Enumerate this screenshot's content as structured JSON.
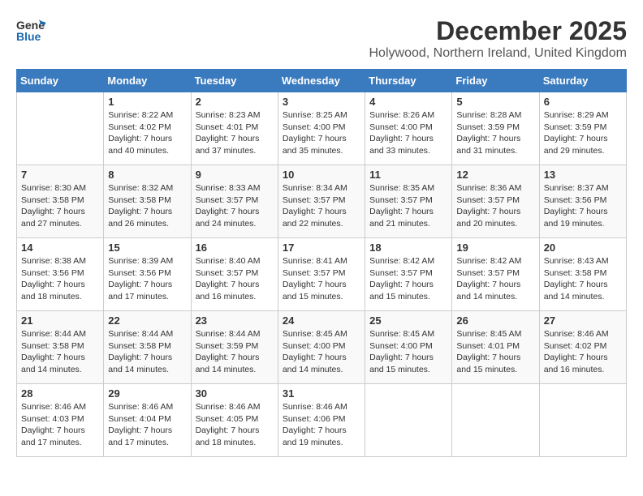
{
  "logo": {
    "text_general": "General",
    "text_blue": "Blue"
  },
  "title": {
    "month": "December 2025",
    "location": "Holywood, Northern Ireland, United Kingdom"
  },
  "weekdays": [
    "Sunday",
    "Monday",
    "Tuesday",
    "Wednesday",
    "Thursday",
    "Friday",
    "Saturday"
  ],
  "weeks": [
    [
      {
        "day": "",
        "sunrise": "",
        "sunset": "",
        "daylight": ""
      },
      {
        "day": "1",
        "sunrise": "Sunrise: 8:22 AM",
        "sunset": "Sunset: 4:02 PM",
        "daylight": "Daylight: 7 hours and 40 minutes."
      },
      {
        "day": "2",
        "sunrise": "Sunrise: 8:23 AM",
        "sunset": "Sunset: 4:01 PM",
        "daylight": "Daylight: 7 hours and 37 minutes."
      },
      {
        "day": "3",
        "sunrise": "Sunrise: 8:25 AM",
        "sunset": "Sunset: 4:00 PM",
        "daylight": "Daylight: 7 hours and 35 minutes."
      },
      {
        "day": "4",
        "sunrise": "Sunrise: 8:26 AM",
        "sunset": "Sunset: 4:00 PM",
        "daylight": "Daylight: 7 hours and 33 minutes."
      },
      {
        "day": "5",
        "sunrise": "Sunrise: 8:28 AM",
        "sunset": "Sunset: 3:59 PM",
        "daylight": "Daylight: 7 hours and 31 minutes."
      },
      {
        "day": "6",
        "sunrise": "Sunrise: 8:29 AM",
        "sunset": "Sunset: 3:59 PM",
        "daylight": "Daylight: 7 hours and 29 minutes."
      }
    ],
    [
      {
        "day": "7",
        "sunrise": "Sunrise: 8:30 AM",
        "sunset": "Sunset: 3:58 PM",
        "daylight": "Daylight: 7 hours and 27 minutes."
      },
      {
        "day": "8",
        "sunrise": "Sunrise: 8:32 AM",
        "sunset": "Sunset: 3:58 PM",
        "daylight": "Daylight: 7 hours and 26 minutes."
      },
      {
        "day": "9",
        "sunrise": "Sunrise: 8:33 AM",
        "sunset": "Sunset: 3:57 PM",
        "daylight": "Daylight: 7 hours and 24 minutes."
      },
      {
        "day": "10",
        "sunrise": "Sunrise: 8:34 AM",
        "sunset": "Sunset: 3:57 PM",
        "daylight": "Daylight: 7 hours and 22 minutes."
      },
      {
        "day": "11",
        "sunrise": "Sunrise: 8:35 AM",
        "sunset": "Sunset: 3:57 PM",
        "daylight": "Daylight: 7 hours and 21 minutes."
      },
      {
        "day": "12",
        "sunrise": "Sunrise: 8:36 AM",
        "sunset": "Sunset: 3:57 PM",
        "daylight": "Daylight: 7 hours and 20 minutes."
      },
      {
        "day": "13",
        "sunrise": "Sunrise: 8:37 AM",
        "sunset": "Sunset: 3:56 PM",
        "daylight": "Daylight: 7 hours and 19 minutes."
      }
    ],
    [
      {
        "day": "14",
        "sunrise": "Sunrise: 8:38 AM",
        "sunset": "Sunset: 3:56 PM",
        "daylight": "Daylight: 7 hours and 18 minutes."
      },
      {
        "day": "15",
        "sunrise": "Sunrise: 8:39 AM",
        "sunset": "Sunset: 3:56 PM",
        "daylight": "Daylight: 7 hours and 17 minutes."
      },
      {
        "day": "16",
        "sunrise": "Sunrise: 8:40 AM",
        "sunset": "Sunset: 3:57 PM",
        "daylight": "Daylight: 7 hours and 16 minutes."
      },
      {
        "day": "17",
        "sunrise": "Sunrise: 8:41 AM",
        "sunset": "Sunset: 3:57 PM",
        "daylight": "Daylight: 7 hours and 15 minutes."
      },
      {
        "day": "18",
        "sunrise": "Sunrise: 8:42 AM",
        "sunset": "Sunset: 3:57 PM",
        "daylight": "Daylight: 7 hours and 15 minutes."
      },
      {
        "day": "19",
        "sunrise": "Sunrise: 8:42 AM",
        "sunset": "Sunset: 3:57 PM",
        "daylight": "Daylight: 7 hours and 14 minutes."
      },
      {
        "day": "20",
        "sunrise": "Sunrise: 8:43 AM",
        "sunset": "Sunset: 3:58 PM",
        "daylight": "Daylight: 7 hours and 14 minutes."
      }
    ],
    [
      {
        "day": "21",
        "sunrise": "Sunrise: 8:44 AM",
        "sunset": "Sunset: 3:58 PM",
        "daylight": "Daylight: 7 hours and 14 minutes."
      },
      {
        "day": "22",
        "sunrise": "Sunrise: 8:44 AM",
        "sunset": "Sunset: 3:58 PM",
        "daylight": "Daylight: 7 hours and 14 minutes."
      },
      {
        "day": "23",
        "sunrise": "Sunrise: 8:44 AM",
        "sunset": "Sunset: 3:59 PM",
        "daylight": "Daylight: 7 hours and 14 minutes."
      },
      {
        "day": "24",
        "sunrise": "Sunrise: 8:45 AM",
        "sunset": "Sunset: 4:00 PM",
        "daylight": "Daylight: 7 hours and 14 minutes."
      },
      {
        "day": "25",
        "sunrise": "Sunrise: 8:45 AM",
        "sunset": "Sunset: 4:00 PM",
        "daylight": "Daylight: 7 hours and 15 minutes."
      },
      {
        "day": "26",
        "sunrise": "Sunrise: 8:45 AM",
        "sunset": "Sunset: 4:01 PM",
        "daylight": "Daylight: 7 hours and 15 minutes."
      },
      {
        "day": "27",
        "sunrise": "Sunrise: 8:46 AM",
        "sunset": "Sunset: 4:02 PM",
        "daylight": "Daylight: 7 hours and 16 minutes."
      }
    ],
    [
      {
        "day": "28",
        "sunrise": "Sunrise: 8:46 AM",
        "sunset": "Sunset: 4:03 PM",
        "daylight": "Daylight: 7 hours and 17 minutes."
      },
      {
        "day": "29",
        "sunrise": "Sunrise: 8:46 AM",
        "sunset": "Sunset: 4:04 PM",
        "daylight": "Daylight: 7 hours and 17 minutes."
      },
      {
        "day": "30",
        "sunrise": "Sunrise: 8:46 AM",
        "sunset": "Sunset: 4:05 PM",
        "daylight": "Daylight: 7 hours and 18 minutes."
      },
      {
        "day": "31",
        "sunrise": "Sunrise: 8:46 AM",
        "sunset": "Sunset: 4:06 PM",
        "daylight": "Daylight: 7 hours and 19 minutes."
      },
      {
        "day": "",
        "sunrise": "",
        "sunset": "",
        "daylight": ""
      },
      {
        "day": "",
        "sunrise": "",
        "sunset": "",
        "daylight": ""
      },
      {
        "day": "",
        "sunrise": "",
        "sunset": "",
        "daylight": ""
      }
    ]
  ]
}
